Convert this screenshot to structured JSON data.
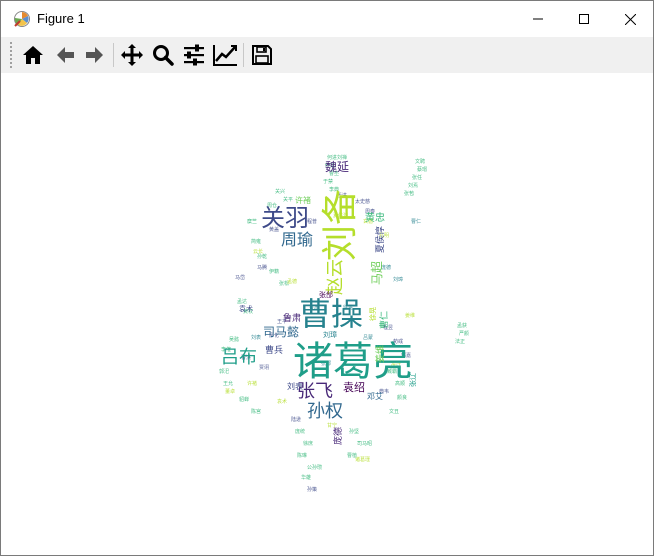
{
  "window": {
    "title": "Figure 1",
    "minimize_label": "Minimize",
    "maximize_label": "Maximize",
    "close_label": "Close"
  },
  "toolbar": {
    "buttons": [
      {
        "name": "home",
        "icon": "home-icon"
      },
      {
        "name": "back",
        "icon": "arrow-left-icon"
      },
      {
        "name": "forward",
        "icon": "arrow-right-icon"
      },
      {
        "name": "pan",
        "icon": "move-icon"
      },
      {
        "name": "zoom",
        "icon": "magnifier-icon"
      },
      {
        "name": "configure-subplots",
        "icon": "sliders-icon"
      },
      {
        "name": "edit-axes",
        "icon": "line-chart-icon"
      },
      {
        "name": "save",
        "icon": "floppy-disk-icon"
      }
    ]
  },
  "wordcloud": {
    "words": {
      "zhugeliang": "诸葛亮",
      "caocao": "曹操",
      "liubei": "刘备",
      "guanyu": "关羽",
      "zhaoyun": "赵云",
      "lvbu": "吕布",
      "zhangfei": "张飞",
      "sunquan": "孙权",
      "zhouyu": "周瑜",
      "simayi": "司马懿",
      "machao": "马超",
      "weiyan": "魏延",
      "huangzhong": "黄忠",
      "yuanshao": "袁绍",
      "xiahoudun": "夏侯惇",
      "caoren": "曹仁",
      "dengai": "邓艾",
      "lusu": "鲁肃",
      "jiangwei": "姜维",
      "zhangliao": "张辽",
      "xuzhu": "许褚",
      "yuanshu": "袁术",
      "caobing": "曹兵",
      "liubiao": "刘表",
      "pangde": "庞德",
      "liuzhang": "刘璋",
      "zhanghe": "张郃",
      "xuhuang": "徐晃",
      "ganning": "甘宁",
      "lvmeng": "吕蒙",
      "zhugejin": "诸葛瑾",
      "dongzhuo": "董卓",
      "xuande": "玄德",
      "kongming": "孔明",
      "yunchang": "云长",
      "mengde": "孟德",
      "sunce": "孙策",
      "luxun": "陆逊",
      "xiahouyuan": "夏侯渊",
      "chengpu": "程普",
      "huanggai": "黄盖",
      "mateng": "马腾",
      "madai": "马岱",
      "wangping": "王平",
      "liaohua": "廖化",
      "caohong": "曹洪",
      "jiaxu": "贾诩",
      "chengyu": "程昱",
      "xunyu": "荀彧",
      "guojia": "郭嘉",
      "dianwei": "典韦",
      "taishici": "太史慈",
      "zhoutai": "周泰",
      "mengong": "孟获",
      "yanyan": "严颜",
      "fazheng": "法正",
      "pangtong": "庞统",
      "xushu": "徐庶",
      "chenlin": "陈琳",
      "wenchou": "文丑",
      "yanliang": "颜良",
      "gongsun": "公孙瓒",
      "huaxiong": "华雄",
      "sunjian": "孙坚",
      "hejin": "何进",
      "liushan": "刘禅",
      "zhongda": "仲达",
      "sima": "司马昭",
      "caopi": "曹丕",
      "caozhi": "曹植",
      "yuji": "于禁",
      "lidian": "李典",
      "lejin": "乐进",
      "wenpin": "文聘",
      "caixun": "蔡瑁",
      "zhangren": "张任",
      "liuyan": "刘焉",
      "zhangbao": "张苞",
      "guanxing": "关兴",
      "guanping": "关平",
      "zhoucang": "周仓",
      "mizhu": "糜竺",
      "jianyong": "简雍",
      "sunqian": "孙乾",
      "yiji": "伊籍",
      "zhanggong": "张松",
      "mengda": "孟达",
      "huangquan": "黄权",
      "wuyi": "吴懿",
      "lijue": "李傕",
      "guosi": "郭汜",
      "wangyun": "王允",
      "diaochan": "貂蝉",
      "chengong": "陈宫",
      "zangba": "臧霸",
      "gaoshun": "高顺"
    }
  },
  "colors": {
    "toolbar_bg": "#f0f0f0",
    "window_border": "#7a7a7a",
    "palette": [
      "#440154",
      "#482878",
      "#3e4a89",
      "#31688e",
      "#26828e",
      "#1f9e89",
      "#35b779",
      "#6ece58",
      "#b5de2b",
      "#fde725"
    ]
  }
}
